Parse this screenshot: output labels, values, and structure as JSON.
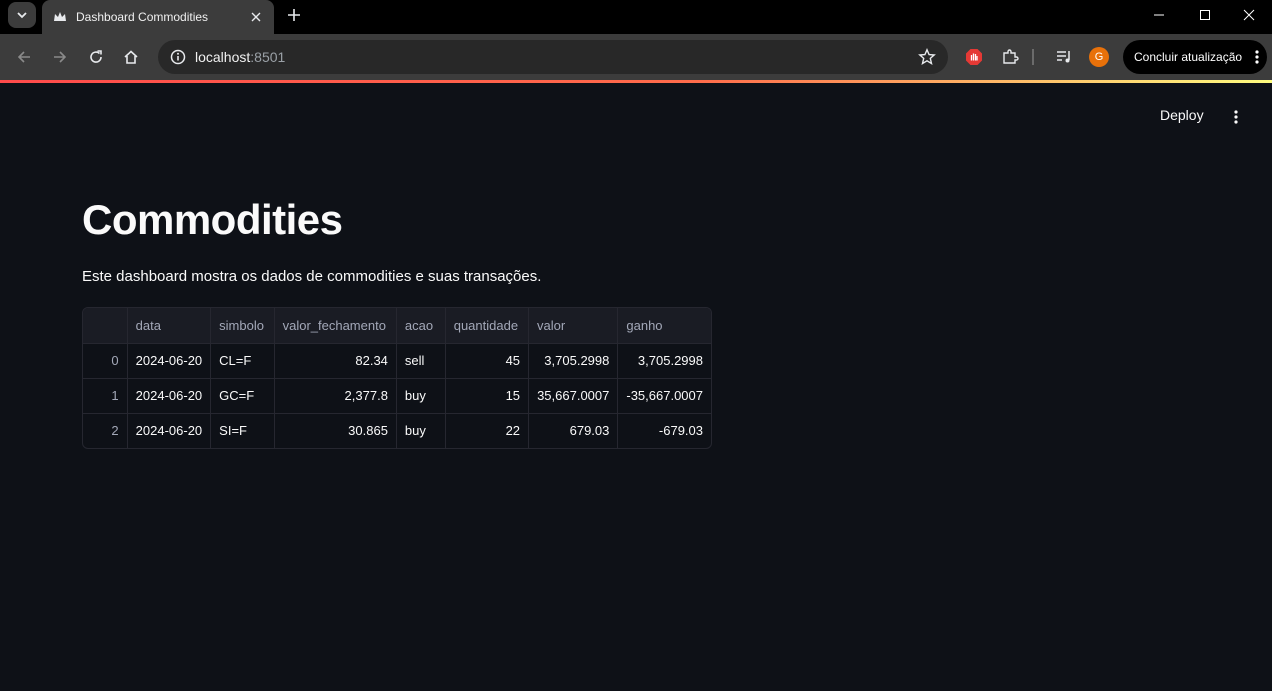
{
  "browser": {
    "tab_title": "Dashboard Commodities",
    "url_host": "localhost",
    "url_port": ":8501",
    "profile_initial": "G",
    "update_label": "Concluir atualização",
    "colors": {
      "chrome": "#3c3c3c",
      "tabstrip": "#000000",
      "avatar": "#e8710a"
    }
  },
  "app": {
    "deploy_label": "Deploy",
    "title": "Commodities",
    "description": "Este dashboard mostra os dados de commodities e suas transações.",
    "table": {
      "columns": [
        "",
        "data",
        "simbolo",
        "valor_fechamento",
        "acao",
        "quantidade",
        "valor",
        "ganho"
      ],
      "rows": [
        [
          "0",
          "2024-06-20",
          "CL=F",
          "82.34",
          "sell",
          "45",
          "3,705.2998",
          "3,705.2998"
        ],
        [
          "1",
          "2024-06-20",
          "GC=F",
          "2,377.8",
          "buy",
          "15",
          "35,667.0007",
          "-35,667.0007"
        ],
        [
          "2",
          "2024-06-20",
          "SI=F",
          "30.865",
          "buy",
          "22",
          "679.03",
          "-679.03"
        ]
      ]
    }
  }
}
